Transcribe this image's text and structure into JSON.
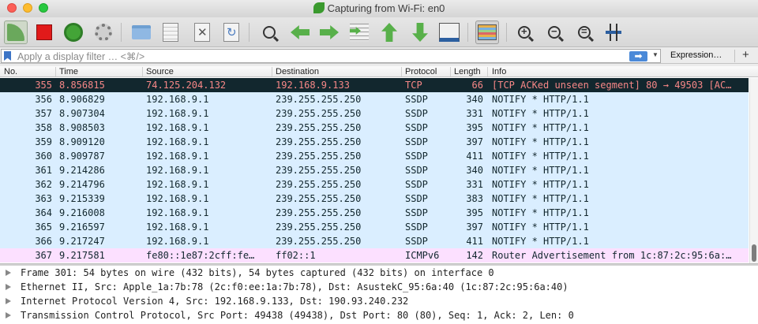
{
  "window": {
    "title": "Capturing from Wi-Fi: en0"
  },
  "toolbar": {
    "buttons": [
      {
        "name": "start-capture-icon"
      },
      {
        "name": "stop-capture-icon"
      },
      {
        "name": "restart-capture-icon"
      },
      {
        "name": "capture-options-icon"
      },
      {
        "name": "open-file-icon"
      },
      {
        "name": "save-file-icon"
      },
      {
        "name": "close-file-icon"
      },
      {
        "name": "reload-file-icon"
      },
      {
        "name": "find-packet-icon"
      },
      {
        "name": "go-back-icon"
      },
      {
        "name": "go-forward-icon"
      },
      {
        "name": "go-to-packet-icon"
      },
      {
        "name": "go-first-packet-icon"
      },
      {
        "name": "go-last-packet-icon"
      },
      {
        "name": "auto-scroll-icon"
      },
      {
        "name": "colorize-icon"
      },
      {
        "name": "zoom-in-icon"
      },
      {
        "name": "zoom-out-icon"
      },
      {
        "name": "normal-size-icon"
      },
      {
        "name": "resize-columns-icon"
      }
    ]
  },
  "filter": {
    "placeholder": "Apply a display filter … <⌘/>",
    "apply_symbol": "➡",
    "dropdown_symbol": "▼",
    "expression_label": "Expression…",
    "add_symbol": "+"
  },
  "packet_list": {
    "columns": [
      "No.",
      "Time",
      "Source",
      "Destination",
      "Protocol",
      "Length",
      "Info"
    ],
    "rows": [
      {
        "no": "355",
        "time": "8.856815",
        "src": "74.125.204.132",
        "dst": "192.168.9.133",
        "proto": "TCP",
        "len": "66",
        "info": "[TCP ACKed unseen segment] 80 → 49503 [AC…",
        "style": "selected"
      },
      {
        "no": "356",
        "time": "8.906829",
        "src": "192.168.9.1",
        "dst": "239.255.255.250",
        "proto": "SSDP",
        "len": "340",
        "info": "NOTIFY * HTTP/1.1",
        "style": "udp"
      },
      {
        "no": "357",
        "time": "8.907304",
        "src": "192.168.9.1",
        "dst": "239.255.255.250",
        "proto": "SSDP",
        "len": "331",
        "info": "NOTIFY * HTTP/1.1",
        "style": "udp"
      },
      {
        "no": "358",
        "time": "8.908503",
        "src": "192.168.9.1",
        "dst": "239.255.255.250",
        "proto": "SSDP",
        "len": "395",
        "info": "NOTIFY * HTTP/1.1",
        "style": "udp"
      },
      {
        "no": "359",
        "time": "8.909120",
        "src": "192.168.9.1",
        "dst": "239.255.255.250",
        "proto": "SSDP",
        "len": "397",
        "info": "NOTIFY * HTTP/1.1",
        "style": "udp"
      },
      {
        "no": "360",
        "time": "8.909787",
        "src": "192.168.9.1",
        "dst": "239.255.255.250",
        "proto": "SSDP",
        "len": "411",
        "info": "NOTIFY * HTTP/1.1",
        "style": "udp"
      },
      {
        "no": "361",
        "time": "9.214286",
        "src": "192.168.9.1",
        "dst": "239.255.255.250",
        "proto": "SSDP",
        "len": "340",
        "info": "NOTIFY * HTTP/1.1",
        "style": "udp"
      },
      {
        "no": "362",
        "time": "9.214796",
        "src": "192.168.9.1",
        "dst": "239.255.255.250",
        "proto": "SSDP",
        "len": "331",
        "info": "NOTIFY * HTTP/1.1",
        "style": "udp"
      },
      {
        "no": "363",
        "time": "9.215339",
        "src": "192.168.9.1",
        "dst": "239.255.255.250",
        "proto": "SSDP",
        "len": "383",
        "info": "NOTIFY * HTTP/1.1",
        "style": "udp"
      },
      {
        "no": "364",
        "time": "9.216008",
        "src": "192.168.9.1",
        "dst": "239.255.255.250",
        "proto": "SSDP",
        "len": "395",
        "info": "NOTIFY * HTTP/1.1",
        "style": "udp"
      },
      {
        "no": "365",
        "time": "9.216597",
        "src": "192.168.9.1",
        "dst": "239.255.255.250",
        "proto": "SSDP",
        "len": "397",
        "info": "NOTIFY * HTTP/1.1",
        "style": "udp"
      },
      {
        "no": "366",
        "time": "9.217247",
        "src": "192.168.9.1",
        "dst": "239.255.255.250",
        "proto": "SSDP",
        "len": "411",
        "info": "NOTIFY * HTTP/1.1",
        "style": "udp"
      },
      {
        "no": "367",
        "time": "9.217581",
        "src": "fe80::1e87:2cff:fe…",
        "dst": "ff02::1",
        "proto": "ICMPv6",
        "len": "142",
        "info": "Router Advertisement from 1c:87:2c:95:6a:…",
        "style": "icmp"
      }
    ]
  },
  "row_styles": {
    "selected": {
      "bg": "#12272e",
      "fg": "#f78787"
    },
    "udp": {
      "bg": "#daeeff",
      "fg": "#12272e"
    },
    "icmp": {
      "bg": "#fce0ff",
      "fg": "#12272e"
    }
  },
  "details": {
    "lines": [
      "Frame 301: 54 bytes on wire (432 bits), 54 bytes captured (432 bits) on interface 0",
      "Ethernet II, Src: Apple_1a:7b:78 (2c:f0:ee:1a:7b:78), Dst: AsustekC_95:6a:40 (1c:87:2c:95:6a:40)",
      "Internet Protocol Version 4, Src: 192.168.9.133, Dst: 190.93.240.232",
      "Transmission Control Protocol, Src Port: 49438 (49438), Dst Port: 80 (80), Seq: 1, Ack: 2, Len: 0"
    ]
  }
}
